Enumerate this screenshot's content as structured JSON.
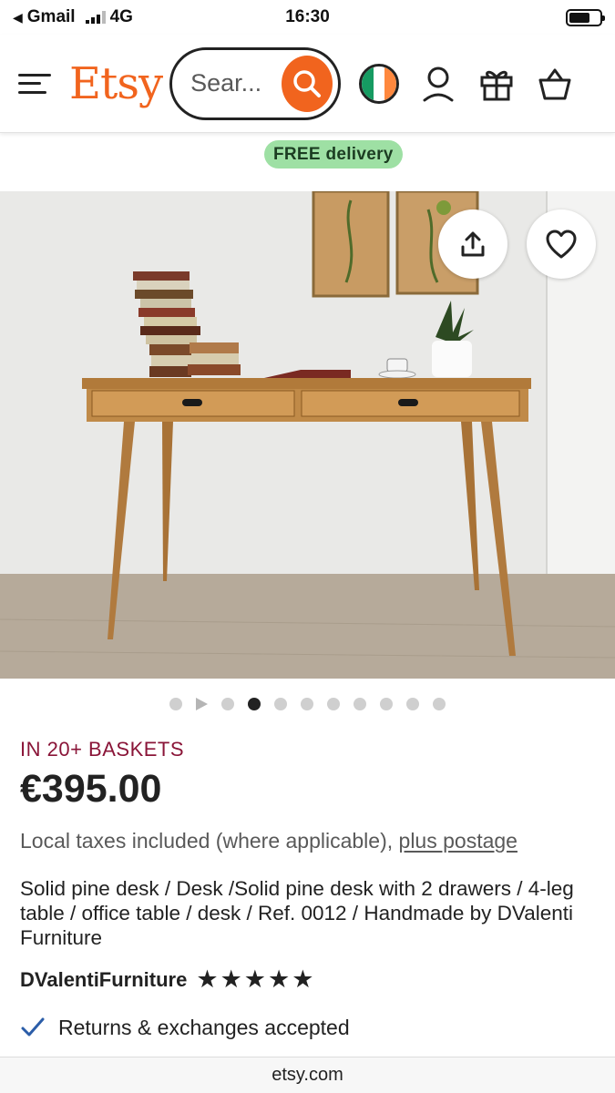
{
  "status_bar": {
    "carrier": "Gmail",
    "network": "4G",
    "time": "16:30",
    "battery_level": 0.7
  },
  "header": {
    "logo": "Etsy",
    "search_placeholder": "Sear...",
    "icons": [
      "menu-icon",
      "search-icon",
      "ireland-flag-icon",
      "account-icon",
      "gift-icon",
      "basket-icon"
    ],
    "brand_color": "#F1641E"
  },
  "badge": {
    "free_delivery": "FREE delivery"
  },
  "gallery": {
    "image_count": 10,
    "active_index": 2,
    "icons": [
      "share-icon",
      "heart-icon"
    ]
  },
  "product": {
    "baskets": "IN 20+ BASKETS",
    "price": "€395.00",
    "taxes_text": "Local taxes included (where applicable),",
    "postage_link": "plus postage",
    "title": "Solid pine desk / Desk /Solid pine desk with 2 drawers / 4-leg table / office table / desk / Ref. 0012 / Handmade by DValenti Furniture",
    "shop_name": "DValentiFurniture",
    "rating_stars": 5,
    "returns": "Returns & exchanges accepted"
  },
  "footer": {
    "url": "etsy.com"
  }
}
